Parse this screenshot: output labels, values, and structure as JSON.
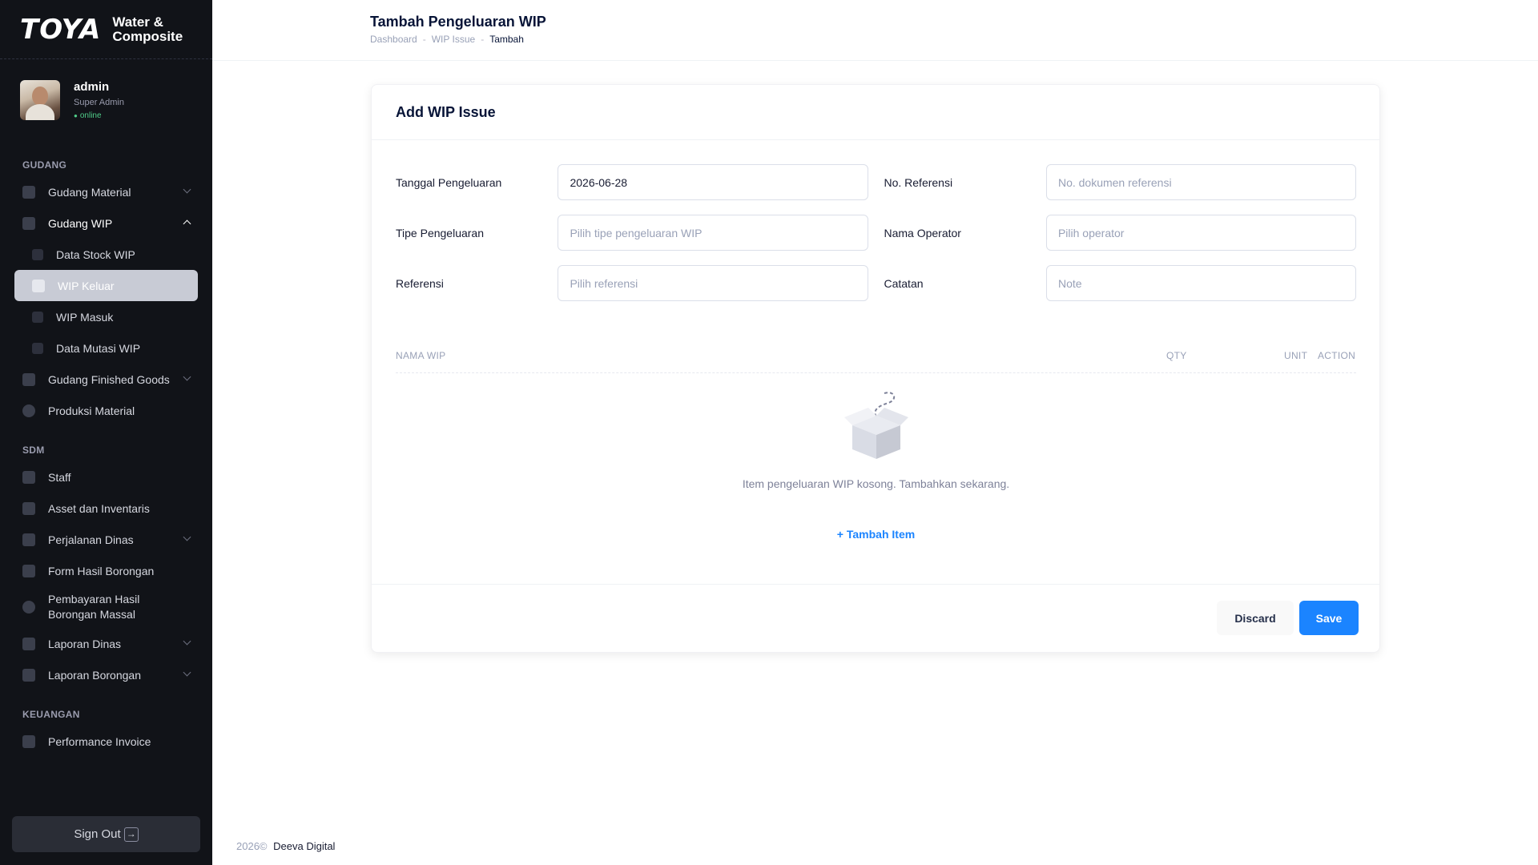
{
  "brand": {
    "logo": "TOYA",
    "subtitle_line1": "Water &",
    "subtitle_line2": "Composite"
  },
  "user": {
    "name": "admin",
    "role": "Super Admin",
    "status": "online"
  },
  "sidebar": {
    "sections": [
      {
        "title": "GUDANG"
      },
      {
        "title": "SDM"
      },
      {
        "title": "KEUANGAN"
      }
    ],
    "items": [
      {
        "label": "Gudang Material"
      },
      {
        "label": "Gudang WIP"
      },
      {
        "label": "Data Stock WIP"
      },
      {
        "label": "WIP Keluar"
      },
      {
        "label": "WIP Masuk"
      },
      {
        "label": "Data Mutasi WIP"
      },
      {
        "label": "Gudang Finished Goods"
      },
      {
        "label": "Produksi Material"
      },
      {
        "label": "Staff"
      },
      {
        "label": "Asset dan Inventaris"
      },
      {
        "label": "Perjalanan Dinas"
      },
      {
        "label": "Form Hasil Borongan"
      },
      {
        "label": "Pembayaran Hasil Borongan Massal"
      },
      {
        "label": "Laporan Dinas"
      },
      {
        "label": "Laporan Borongan"
      },
      {
        "label": "Performance Invoice"
      }
    ],
    "signout_label": "Sign Out"
  },
  "header": {
    "title": "Tambah Pengeluaran WIP",
    "breadcrumb": [
      "Dashboard",
      "WIP Issue",
      "Tambah"
    ]
  },
  "card": {
    "title": "Add WIP Issue",
    "fields": {
      "tanggal_label": "Tanggal Pengeluaran",
      "tanggal_value": "2026-06-28",
      "noref_label": "No. Referensi",
      "noref_placeholder": "No. dokumen referensi",
      "tipe_label": "Tipe Pengeluaran",
      "tipe_placeholder": "Pilih tipe pengeluaran WIP",
      "operator_label": "Nama Operator",
      "operator_placeholder": "Pilih operator",
      "ref_label": "Referensi",
      "ref_placeholder": "Pilih referensi",
      "catatan_label": "Catatan",
      "catatan_placeholder": "Note"
    },
    "table": {
      "columns": [
        "NAMA WIP",
        "QTY",
        "UNIT",
        "ACTION"
      ]
    },
    "empty_text": "Item pengeluaran WIP kosong. Tambahkan sekarang.",
    "add_item_label": "+ Tambah Item",
    "discard_label": "Discard",
    "save_label": "Save"
  },
  "footer": {
    "year": "2026©",
    "company": "Deeva Digital"
  }
}
